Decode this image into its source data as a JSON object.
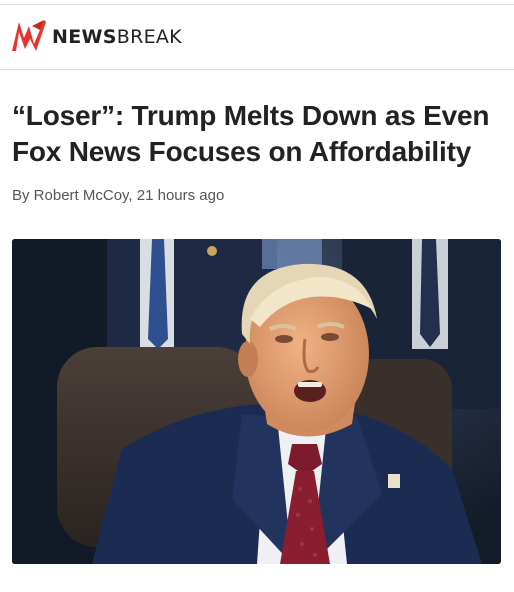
{
  "header": {
    "brand_bold": "NEWS",
    "brand_light": "BREAK",
    "logo_color": "#e8352b",
    "logo_icon": "newsbreak-logo-icon"
  },
  "article": {
    "title": "“Loser”: Trump Melts Down as Even Fox News Focuses on Affordability",
    "byline": "By Robert McCoy, 21 hours ago"
  },
  "colors": {
    "text": "#222222",
    "byline": "#555555",
    "divider": "#dedede"
  }
}
